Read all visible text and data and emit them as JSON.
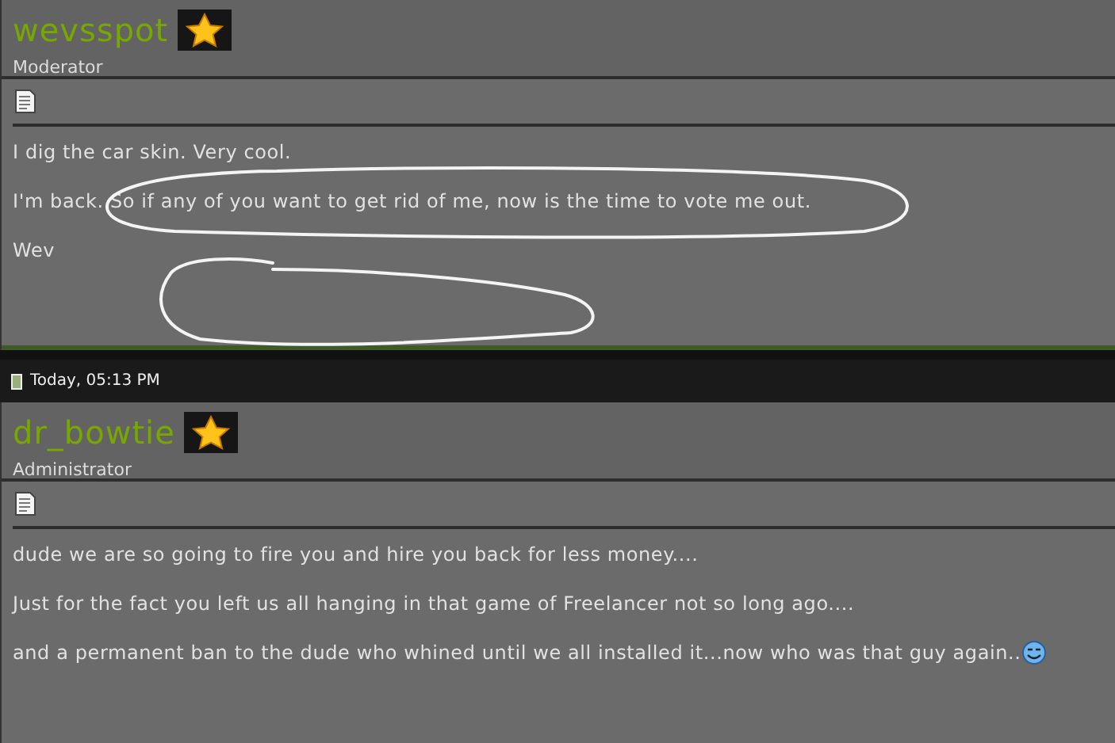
{
  "posts": [
    {
      "author": "wevsspot",
      "rank": "Moderator",
      "marked_up": true,
      "lines": [
        "I dig the car skin. Very cool.",
        "I'm back. So if any of you want to get rid of me, now is the time to vote me out.",
        "Wev"
      ],
      "smiley": false
    },
    {
      "date": "Today, 05:13 PM",
      "author": "dr_bowtie",
      "rank": "Administrator",
      "marked_up": false,
      "lines": [
        "dude we are so going to fire you and hire you back for less money....",
        "Just for the fact you left us all hanging in that game of Freelancer not so long ago....",
        "and a permanent ban to the dude who whined until we all installed it...now who was that guy again.."
      ],
      "smiley": true
    }
  ]
}
